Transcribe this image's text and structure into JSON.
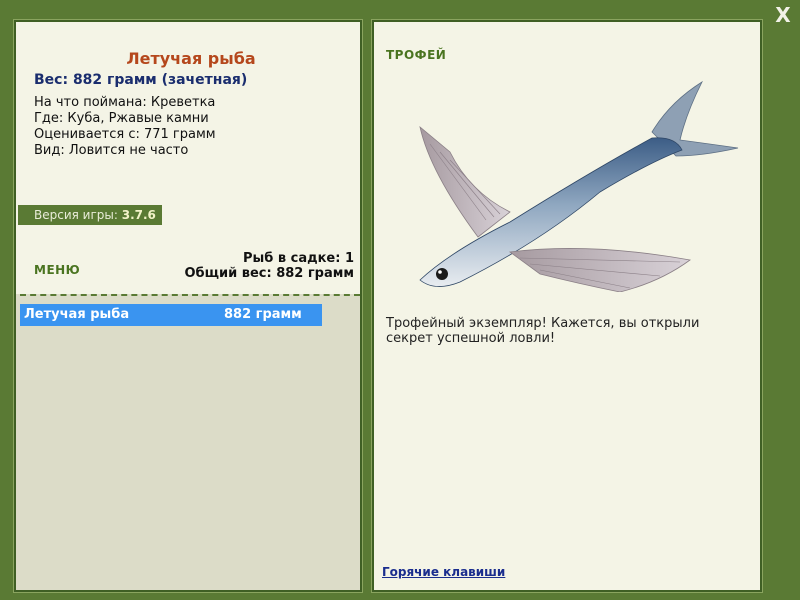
{
  "close_button": {
    "label": "X"
  },
  "fish": {
    "name": "Летучая рыба",
    "weight_line": "Вес: 882 грамм (зачетная)",
    "details": [
      "На что поймана: Креветка",
      "Где: Куба, Ржавые камни",
      "Оценивается с: 771 грамм",
      "Вид: Ловится не часто"
    ]
  },
  "version": {
    "label": "Версия игры:",
    "value": "3.7.6"
  },
  "menu": {
    "label": "МЕНЮ"
  },
  "keepnet": {
    "count_line": "Рыб в садке: 1",
    "total_line": "Общий вес: 882 грамм"
  },
  "catch_list": [
    {
      "name": "Летучая рыба",
      "weight": "882 грамм"
    }
  ],
  "trophy": {
    "label": "ТРОФЕЙ",
    "message": "Трофейный экземпляр! Кажется, вы открыли секрет успешной ловли!",
    "image_icon": "flying-fish-image"
  },
  "hotkeys": {
    "label": "Горячие клавиши"
  },
  "colors": {
    "frame": "#5a7a34",
    "title": "#b5471c",
    "weight": "#1a2d6e",
    "selection": "#3a94f0",
    "panel_bg": "#f4f4e6"
  }
}
